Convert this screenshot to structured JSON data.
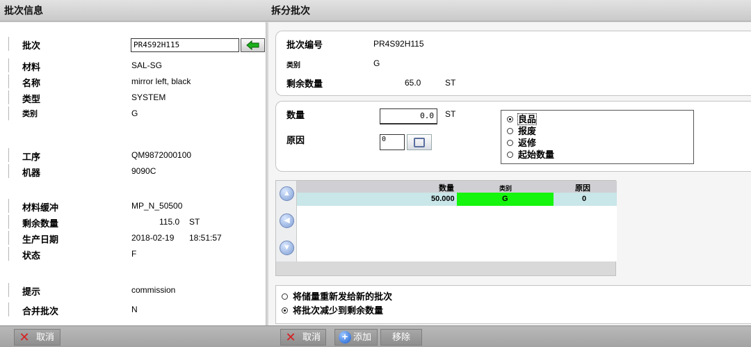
{
  "left": {
    "header": "批次信息",
    "batch_label": "批次",
    "batch_value": "PR4S92H115",
    "rows": [
      {
        "label": "材料",
        "value": "SAL-SG"
      },
      {
        "label": "名称",
        "value": "mirror left, black"
      },
      {
        "label": "类型",
        "value": "SYSTEM"
      },
      {
        "label": "类别",
        "value": "G"
      },
      {
        "label": "工序",
        "value": "QM9872000100"
      },
      {
        "label": "机器",
        "value": "9090C"
      },
      {
        "label": "材料缓冲",
        "value": "MP_N_50500"
      },
      {
        "label": "剩余数量",
        "value": "115.0",
        "unit": "ST"
      },
      {
        "label": "生产日期",
        "value": "2018-02-19",
        "value2": "18:51:57"
      },
      {
        "label": "状态",
        "value": "F"
      },
      {
        "label": "提示",
        "value": "commission"
      },
      {
        "label": "合并批次",
        "value": "N"
      }
    ],
    "footer": {
      "cancel": "取消"
    }
  },
  "right": {
    "header": "拆分批次",
    "info": {
      "batch_no_label": "批次编号",
      "batch_no": "PR4S92H115",
      "category_label": "类别",
      "category": "G",
      "remaining_label": "剩余数量",
      "remaining": "65.0",
      "remaining_unit": "ST"
    },
    "split": {
      "qty_label": "数量",
      "qty_value": "0.0",
      "qty_unit": "ST",
      "reason_label": "原因",
      "reason_value": "0",
      "options": [
        {
          "label": "良品",
          "selected": true
        },
        {
          "label": "报废",
          "selected": false
        },
        {
          "label": "返修",
          "selected": false
        },
        {
          "label": "起始数量",
          "selected": false
        }
      ]
    },
    "grid": {
      "headers": [
        "数量",
        "类别",
        "原因"
      ],
      "rows": [
        {
          "qty": "50.000",
          "category": "G",
          "reason": "0"
        }
      ],
      "accent": "#16f50d"
    },
    "mode": {
      "options": [
        {
          "label": "将储量重新发给新的批次",
          "selected": false
        },
        {
          "label": "将批次减少到剩余数量",
          "selected": true
        }
      ]
    },
    "footer": {
      "cancel": "取消",
      "add": "添加",
      "remove": "移除"
    }
  }
}
